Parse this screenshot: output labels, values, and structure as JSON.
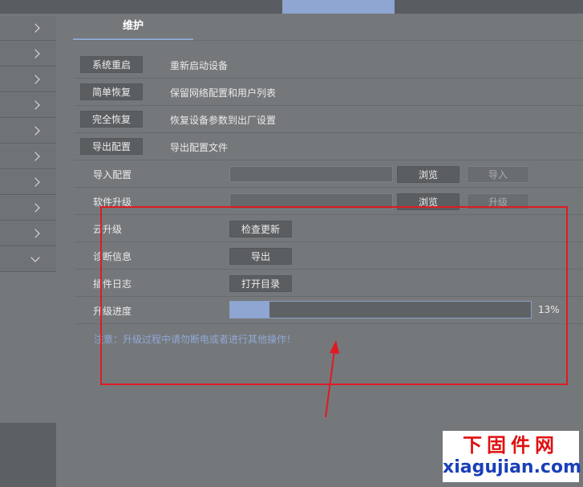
{
  "main": {
    "subtab_label": "维护",
    "rows": [
      {
        "button": "系统重启",
        "desc": "重新启动设备"
      },
      {
        "button": "简单恢复",
        "desc": "保留网络配置和用户列表"
      },
      {
        "button": "完全恢复",
        "desc": "恢复设备参数到出厂设置"
      },
      {
        "button": "导出配置",
        "desc": "导出配置文件"
      }
    ],
    "import_config": {
      "label": "导入配置",
      "browse": "浏览",
      "action": "导入"
    },
    "firmware_upgrade": {
      "label": "软件升级",
      "browse": "浏览",
      "action": "升级"
    },
    "cloud_upgrade": {
      "label": "云升级",
      "button": "检查更新"
    },
    "diagnostics": {
      "label": "诊断信息",
      "button": "导出"
    },
    "plugin_log": {
      "label": "插件日志",
      "button": "打开目录"
    },
    "upgrade_progress": {
      "label": "升级进度",
      "percent": 13,
      "percent_text": "13%"
    },
    "notice": "注意：升级过程中请勿断电或者进行其他操作！"
  },
  "watermark": {
    "cn": "下固件网",
    "url": "xiagujian.com"
  },
  "colors": {
    "accent": "#8ea6d1",
    "annotation_red": "#e01a22",
    "notice_text": "#8fa8d6",
    "background": "#75787b"
  }
}
